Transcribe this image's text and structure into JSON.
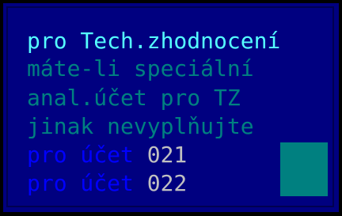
{
  "colors": {
    "background": "#000080",
    "outer": "#000000",
    "heading": "#55ffff",
    "hint": "#008080",
    "account_label": "#0000ff",
    "account_value": "#c0c0c0",
    "input_box": "#008080"
  },
  "dialog": {
    "heading": "pro Tech.zhodnocení",
    "hint_lines": [
      "máte-li speciální",
      "anal.účet pro TZ",
      "jinak nevyplňujte"
    ],
    "accounts": [
      {
        "label": "pro účet",
        "value": "021"
      },
      {
        "label": "pro účet",
        "value": "022"
      }
    ]
  }
}
